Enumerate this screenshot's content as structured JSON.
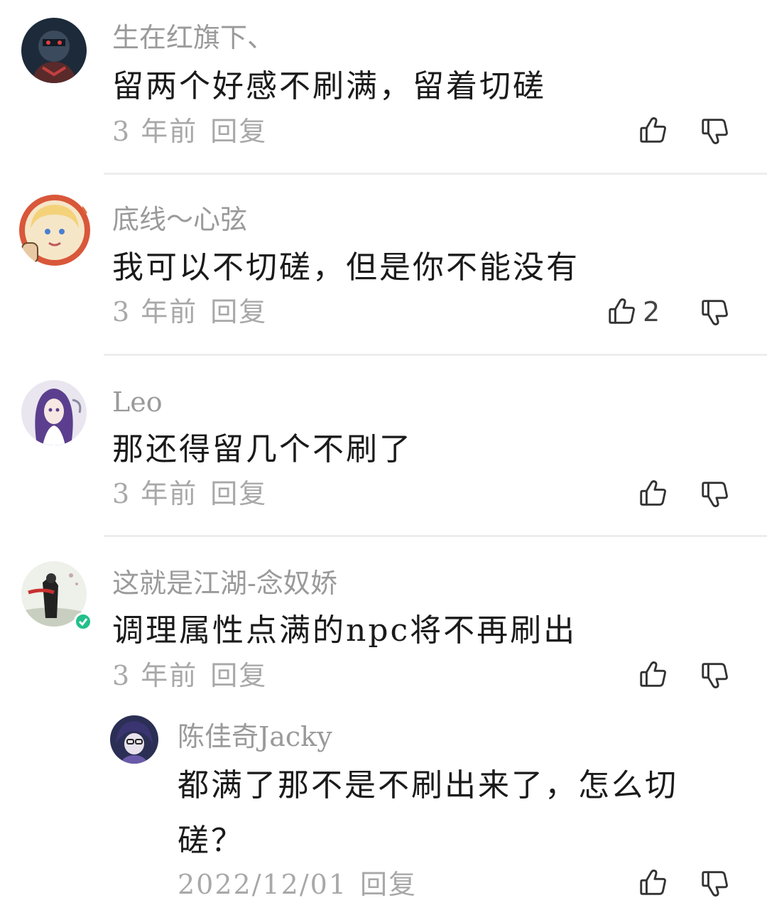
{
  "comments": [
    {
      "username": "生在红旗下、",
      "content": "留两个好感不刷满，留着切磋",
      "time": "3 年前",
      "reply_label": "回复",
      "likes": "",
      "avatar_icon": "avatar-dark-robot"
    },
    {
      "username": "底线～心弦",
      "content": "我可以不切磋，但是你不能没有",
      "time": "3 年前",
      "reply_label": "回复",
      "likes": "2",
      "avatar_icon": "avatar-blonde-character"
    },
    {
      "username": "Leo",
      "content": "那还得留几个不刷了",
      "time": "3 年前",
      "reply_label": "回复",
      "likes": "",
      "avatar_icon": "avatar-purple-hair-girl"
    },
    {
      "username": "这就是江湖-念奴娇",
      "content": "调理属性点满的npc将不再刷出",
      "time": "3 年前",
      "reply_label": "回复",
      "likes": "",
      "avatar_icon": "avatar-swordsman-painting",
      "verified": true
    }
  ],
  "sub_reply": {
    "username": "陈佳奇Jacky",
    "content_line1": "都满了那不是不刷出来了，怎么切",
    "content_line2": "磋？",
    "time": "2022/12/01",
    "reply_label": "回复",
    "avatar_icon": "avatar-dark-hair-character"
  },
  "icons": {
    "like": "thumbs-up-icon",
    "dislike": "thumbs-down-icon",
    "verified": "verified-badge-icon"
  },
  "colors": {
    "username": "#9a9a9a",
    "content": "#1a1a1a",
    "meta": "#a8a8a8",
    "divider": "#ededed",
    "verified": "#22c08a"
  }
}
